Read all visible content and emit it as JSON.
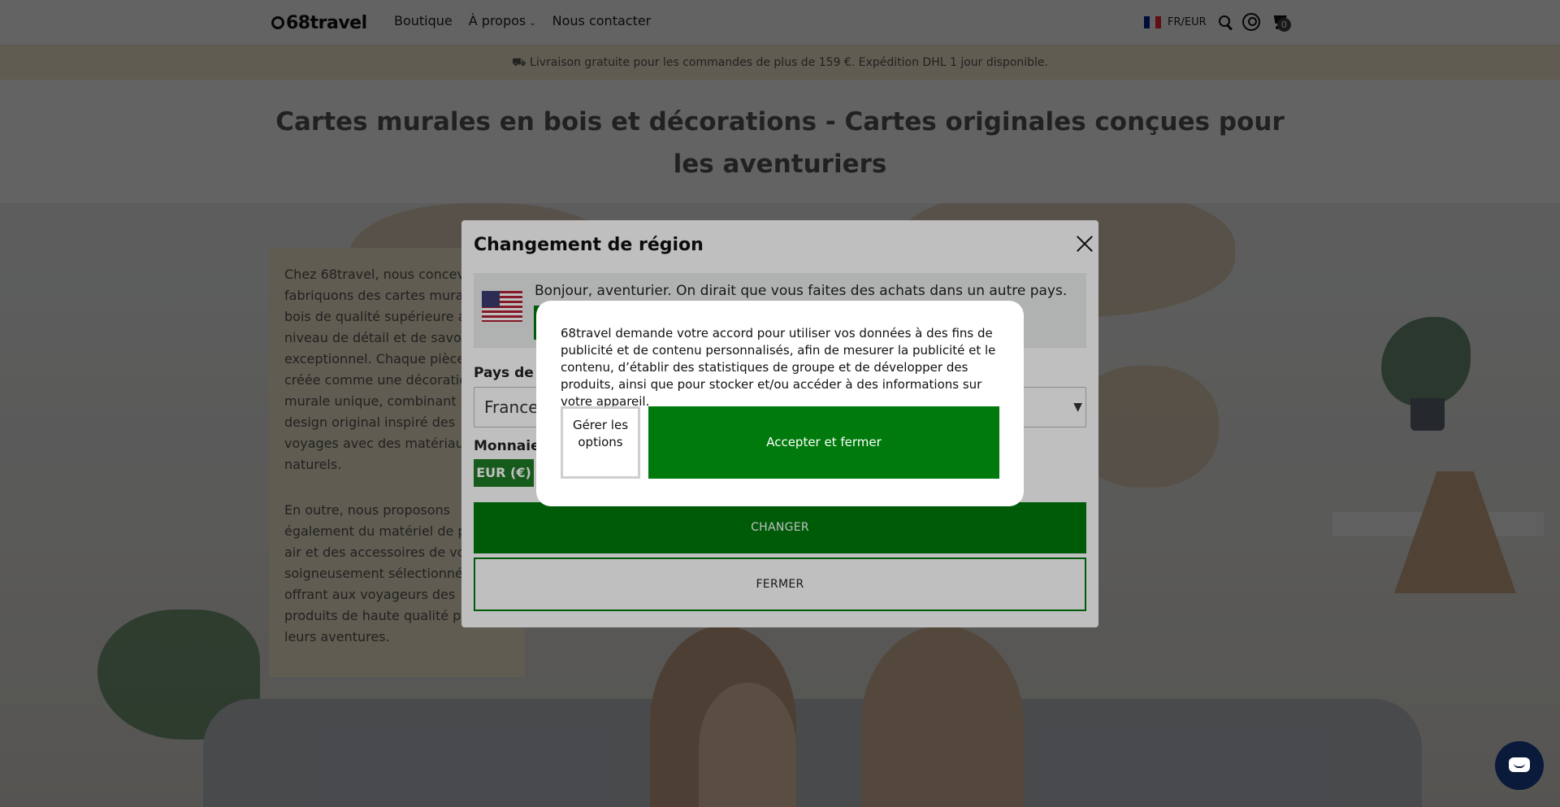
{
  "header": {
    "logo": "68travel",
    "nav": [
      "Boutique",
      "À propos",
      "Nous contacter"
    ],
    "locale": "FR/EUR",
    "cart_count": "0"
  },
  "announcement": "Livraison gratuite pour les commandes de plus de 159 €. Expédition DHL 1 jour disponible.",
  "page": {
    "title": "Cartes murales en bois et décorations - Cartes originales conçues pour les aventuriers",
    "intro_p1": "Chez 68travel, nous concevons et fabriquons des cartes murales en bois de qualité supérieure avec un niveau de détail et de savoir-faire exceptionnel. Chaque pièce est créée comme une décoration murale unique, combinant un design original inspiré des voyages avec des matériaux naturels.",
    "intro_p2": "En outre, nous proposons également du matériel de plein air et des accessoires de voyage soigneusement sélectionnés, offrant aux voyageurs des produits de haute qualité pour leurs aventures."
  },
  "region_modal": {
    "title": "Changement de région",
    "us_message": "Bonjour, aventurier. On dirait que vous faites des achats dans un autre pays.",
    "country_label": "Pays de livraison",
    "country_value": "France",
    "currency_label": "Monnaie",
    "currency_value": "EUR (€)",
    "change_label": "CHANGER",
    "close_label": "FERMER"
  },
  "consent": {
    "text": "68travel demande votre accord pour utiliser vos données à des fins de publicité et de contenu personnalisés, afin de mesurer la publicité et le contenu, d’établir des statistiques de groupe et de développer des produits, ainsi que pour stocker et/ou accéder à des informations sur votre appareil.",
    "manage_label": "Gérer les options",
    "accept_label": "Accepter et fermer"
  },
  "colors": {
    "brand_green": "#007a0d",
    "announce_bg": "#f6eccf"
  }
}
